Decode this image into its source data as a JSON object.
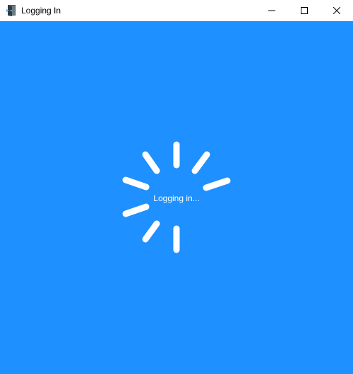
{
  "window": {
    "title": "Logging In",
    "icon": "app-door-icon",
    "controls": [
      "minimize-icon",
      "maximize-icon",
      "close-icon"
    ]
  },
  "content": {
    "background_color": "#1e90ff",
    "status_text": "Logging in...",
    "spinner": {
      "icon": "loading-spinner-icon",
      "color": "#ffffff"
    }
  }
}
